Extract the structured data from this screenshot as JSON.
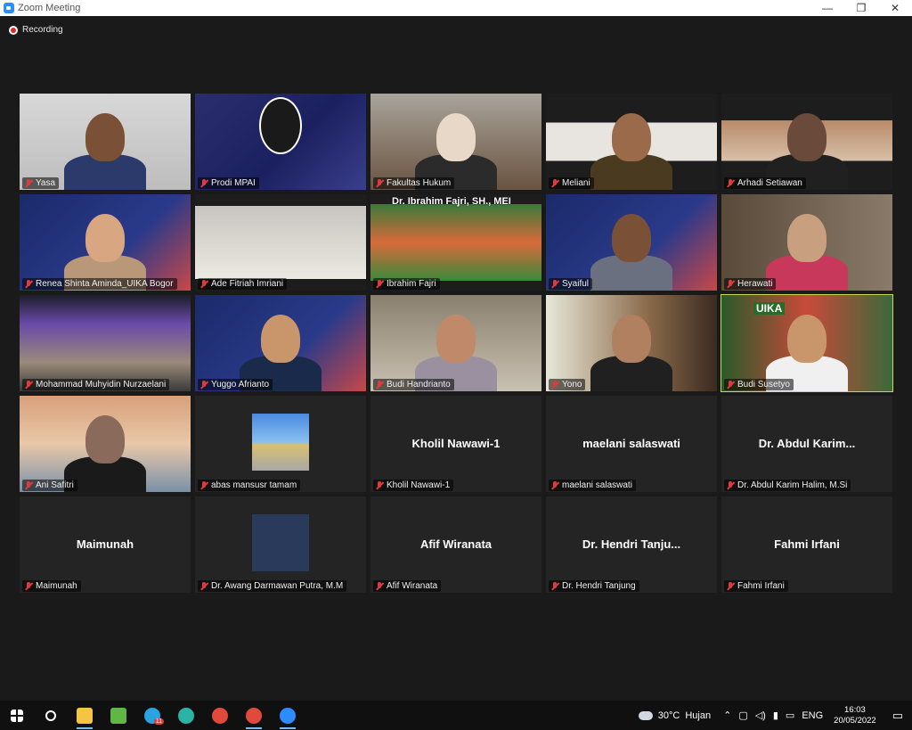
{
  "window": {
    "title": "Zoom Meeting",
    "min": "—",
    "max": "❐",
    "close": "✕"
  },
  "recording": {
    "label": "Recording",
    "color": "#e02828"
  },
  "tiles": [
    {
      "name": "Yasa",
      "video": true
    },
    {
      "name": "Prodi MPAI",
      "video": true
    },
    {
      "name": "Fakultas Hukum",
      "video": true
    },
    {
      "name": "Meliani",
      "video": true
    },
    {
      "name": "Arhadi Setiawan",
      "video": true
    },
    {
      "name": "Renea Shinta Aminda_UIKA Bogor",
      "video": true
    },
    {
      "name": "Ade Fitriah Imriani",
      "video": true
    },
    {
      "name": "Ibrahim Fajri",
      "video": true,
      "overlay": "Dr. Ibrahim Fajri, SH., MEI"
    },
    {
      "name": "Syaiful",
      "video": true
    },
    {
      "name": "Herawati",
      "video": true
    },
    {
      "name": "Mohammad Muhyidin Nurzaelani",
      "video": true
    },
    {
      "name": "Yuggo Afrianto",
      "video": true
    },
    {
      "name": "Budi Handrianto",
      "video": true
    },
    {
      "name": "Yono",
      "video": true
    },
    {
      "name": "Budi Susetyo",
      "video": true,
      "active": true,
      "overlay": "UIKA"
    },
    {
      "name": "Ani Safitri",
      "video": true
    },
    {
      "name": "abas mansusr tamam",
      "video": false
    },
    {
      "name": "Kholil Nawawi-1",
      "video": false,
      "display": "Kholil Nawawi-1"
    },
    {
      "name": "maelani salaswati",
      "video": false,
      "display": "maelani salaswati"
    },
    {
      "name": "Dr. Abdul Karim Halim, M.Si",
      "video": false,
      "display": "Dr. Abdul Karim..."
    },
    {
      "name": "Maimunah",
      "video": false,
      "display": "Maimunah"
    },
    {
      "name": "Dr. Awang Darmawan Putra, M.M",
      "video": false
    },
    {
      "name": "Afif Wiranata",
      "video": false,
      "display": "Afif Wiranata"
    },
    {
      "name": "Dr. Hendri Tanjung",
      "video": false,
      "display": "Dr. Hendri Tanju..."
    },
    {
      "name": "Fahmi Irfani",
      "video": false,
      "display": "Fahmi Irfani"
    }
  ],
  "taskbar": {
    "apps": [
      {
        "icon": "windows-start-icon",
        "color": "#ffffff"
      },
      {
        "icon": "search-icon",
        "color": "#ffffff"
      },
      {
        "icon": "file-explorer-icon",
        "color": "#f4c542",
        "open": true
      },
      {
        "icon": "app-green-icon",
        "color": "#5fb845"
      },
      {
        "icon": "telegram-icon",
        "color": "#2aa3df",
        "badge": "11"
      },
      {
        "icon": "edge-icon",
        "color": "#2bb3a6"
      },
      {
        "icon": "chrome-icon",
        "color": "#e04a3a"
      },
      {
        "icon": "chrome-profile-icon",
        "color": "#e04a3a",
        "open": true
      },
      {
        "icon": "zoom-icon",
        "color": "#2d8cff",
        "open": true
      }
    ],
    "weather": {
      "temp": "30°C",
      "label": "Hujan"
    },
    "lang": "ENG",
    "time": "16:03",
    "date": "20/05/2022"
  }
}
